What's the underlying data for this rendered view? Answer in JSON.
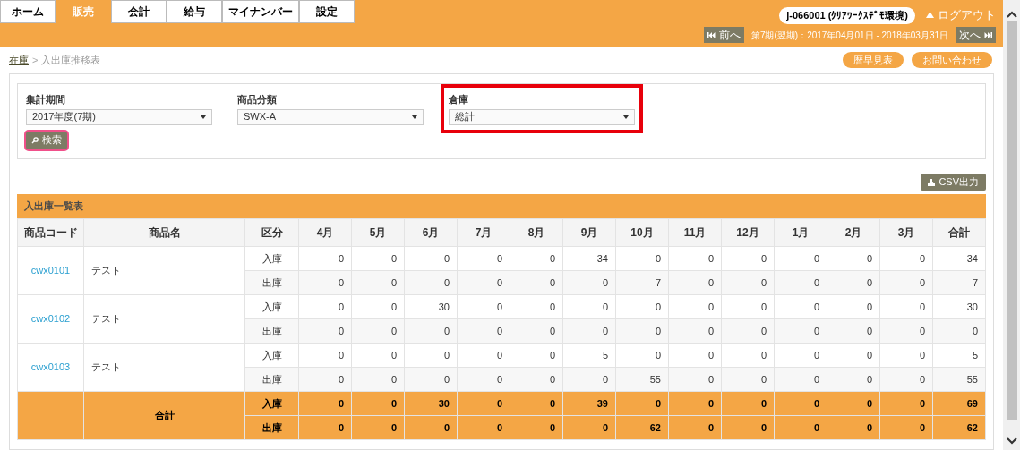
{
  "tabs": [
    {
      "label": "ホーム",
      "selected": false
    },
    {
      "label": "販売",
      "selected": true
    },
    {
      "label": "会計",
      "selected": false
    },
    {
      "label": "給与",
      "selected": false
    },
    {
      "label": "マイナンバー",
      "selected": false
    },
    {
      "label": "設定",
      "selected": false
    }
  ],
  "user": {
    "account": "j-066001 (ｸﾘｱﾜｰｸｽﾃﾞﾓ環境)",
    "logout": "ログアウト"
  },
  "period": {
    "prev": "前へ",
    "label": "第7期(翌期)：2017年04月01日 - 2018年03月31日",
    "next": "次へ"
  },
  "breadcrumb": {
    "parent": "在庫",
    "separator": ">",
    "current": "入出庫推移表"
  },
  "header_buttons": [
    "暦早見表",
    "お問い合わせ"
  ],
  "filters": [
    {
      "label": "集計期間",
      "value": "2017年度(7期)",
      "highlighted": false
    },
    {
      "label": "商品分類",
      "value": "SWX-A",
      "highlighted": false
    },
    {
      "label": "倉庫",
      "value": "総計",
      "highlighted": true
    }
  ],
  "search_button": {
    "label": "検索",
    "focused": true
  },
  "csv_button": "CSV出力",
  "table": {
    "title": "入出庫一覧表",
    "columns": [
      "商品コード",
      "商品名",
      "区分",
      "4月",
      "5月",
      "6月",
      "7月",
      "8月",
      "9月",
      "10月",
      "11月",
      "12月",
      "1月",
      "2月",
      "3月",
      "合計"
    ],
    "rows": [
      {
        "code": "cwx0101",
        "name": "テスト",
        "lines": [
          {
            "kind": "in",
            "label": "入庫",
            "values": [
              "0",
              "0",
              "0",
              "0",
              "0",
              "34",
              "0",
              "0",
              "0",
              "0",
              "0",
              "0",
              "34"
            ]
          },
          {
            "kind": "out",
            "label": "出庫",
            "values": [
              "0",
              "0",
              "0",
              "0",
              "0",
              "0",
              "7",
              "0",
              "0",
              "0",
              "0",
              "0",
              "7"
            ]
          }
        ]
      },
      {
        "code": "cwx0102",
        "name": "テスト",
        "lines": [
          {
            "kind": "in",
            "label": "入庫",
            "values": [
              "0",
              "0",
              "30",
              "0",
              "0",
              "0",
              "0",
              "0",
              "0",
              "0",
              "0",
              "0",
              "30"
            ]
          },
          {
            "kind": "out",
            "label": "出庫",
            "values": [
              "0",
              "0",
              "0",
              "0",
              "0",
              "0",
              "0",
              "0",
              "0",
              "0",
              "0",
              "0",
              "0"
            ]
          }
        ]
      },
      {
        "code": "cwx0103",
        "name": "テスト",
        "lines": [
          {
            "kind": "in",
            "label": "入庫",
            "values": [
              "0",
              "0",
              "0",
              "0",
              "0",
              "5",
              "0",
              "0",
              "0",
              "0",
              "0",
              "0",
              "5"
            ]
          },
          {
            "kind": "out",
            "label": "出庫",
            "values": [
              "0",
              "0",
              "0",
              "0",
              "0",
              "0",
              "55",
              "0",
              "0",
              "0",
              "0",
              "0",
              "55"
            ]
          }
        ]
      }
    ],
    "total": {
      "label": "合計",
      "lines": [
        {
          "label": "入庫",
          "values": [
            "0",
            "0",
            "30",
            "0",
            "0",
            "39",
            "0",
            "0",
            "0",
            "0",
            "0",
            "0",
            "69"
          ]
        },
        {
          "label": "出庫",
          "values": [
            "0",
            "0",
            "0",
            "0",
            "0",
            "0",
            "62",
            "0",
            "0",
            "0",
            "0",
            "0",
            "62"
          ]
        }
      ]
    }
  }
}
